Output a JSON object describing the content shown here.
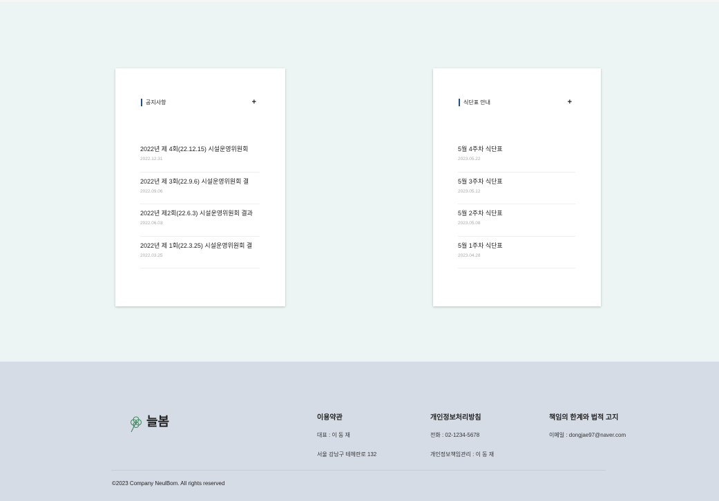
{
  "cards": [
    {
      "title": "공지사항",
      "more_label": "+",
      "items": [
        {
          "title": "2022년 제 4회(22.12.15) 시설운영위원회",
          "date": "2022.12.31"
        },
        {
          "title": "2022년 제 3회(22.9.6) 시설운영위원회 결",
          "date": "2022.09.06"
        },
        {
          "title": "2022년 제2회(22.6.3) 시설운영위원회 결과",
          "date": "2022.06.03"
        },
        {
          "title": "2022년 제 1회(22.3.25) 시설운영위원회 결",
          "date": "2022.03.25"
        }
      ]
    },
    {
      "title": "식단표 안내",
      "more_label": "+",
      "items": [
        {
          "title": "5월 4주차 식단표",
          "date": "2023.05.22"
        },
        {
          "title": "5월 3주차 식단표",
          "date": "2023.05.12"
        },
        {
          "title": "5월 2주차 식단표",
          "date": "2023.05.08"
        },
        {
          "title": "5월 1주차 식단표",
          "date": "2023.04.28"
        }
      ]
    }
  ],
  "footer": {
    "logo_text": "늘봄",
    "logo_icon": "clover-icon",
    "columns": [
      {
        "title": "이용약관",
        "lines": [
          "대표 : 이 동 재",
          "서울 강남구 테헤란로 132"
        ]
      },
      {
        "title": "개인정보처리방침",
        "lines": [
          "전화 : 02-1234-5678",
          "개인정보책임관리 : 이 동 재"
        ]
      },
      {
        "title": "책임의 한계와 법적 고지",
        "lines": [
          "이메일 : dongjae97@naver.com"
        ]
      }
    ],
    "copyright": "©2023 Company NeulBom. All rights reserved"
  },
  "colors": {
    "accent": "#1d4f99",
    "main_background": "#ecf5f3",
    "footer_background": "#d5dce6",
    "logo_icon": "#3d8b5e"
  }
}
